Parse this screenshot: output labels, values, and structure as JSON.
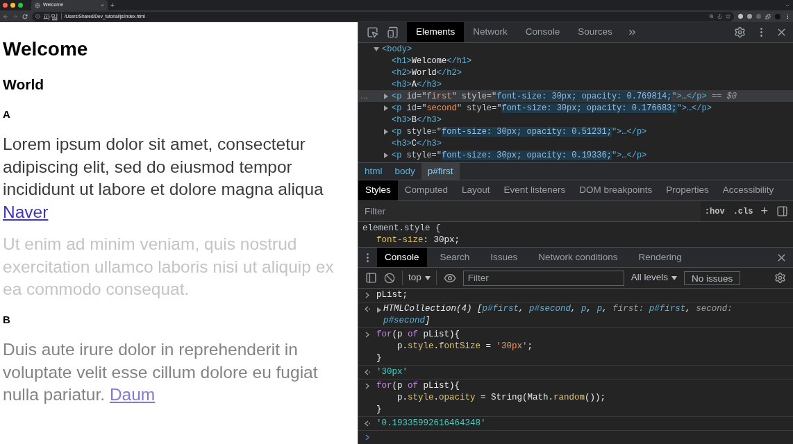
{
  "browser": {
    "tab": {
      "title": "Welcome",
      "close": "×"
    },
    "new_tab": "+",
    "address": {
      "scheme": "파일",
      "url": "/Users/Shared/Dev_tutorial/js/index.html"
    }
  },
  "page": {
    "blocks": [
      {
        "kind": "h1",
        "text": "Welcome"
      },
      {
        "kind": "h2",
        "text": "World"
      },
      {
        "kind": "h3",
        "text": "A"
      },
      {
        "kind": "p",
        "color": "#3b3b3b",
        "text": "Lorem ipsum dolor sit amet, consectetur adipiscing elit, sed do eiusmod tempor incididunt ut labore et dolore magna aliqua",
        "link": {
          "text": "Naver",
          "color": "#3f37b9"
        }
      },
      {
        "kind": "p",
        "color": "#c4c4c4",
        "text": "Ut enim ad minim veniam, quis nostrud exercitation ullamco laboris nisi ut aliquip ex ea commodo consequat."
      },
      {
        "kind": "h3",
        "text": "B"
      },
      {
        "kind": "p",
        "color": "#838383",
        "text": "Duis aute irure dolor in reprehenderit in voluptate velit esse cillum dolore eu fugiat nulla pariatur.",
        "link": {
          "text": "Daum",
          "color": "#7f79d2"
        }
      }
    ]
  },
  "devtools": {
    "tabs": [
      {
        "label": "Elements",
        "selected": true
      },
      {
        "label": "Network",
        "selected": false
      },
      {
        "label": "Console",
        "selected": false
      },
      {
        "label": "Sources",
        "selected": false
      }
    ],
    "tree": [
      {
        "selected": false,
        "expanded": true,
        "segments": [
          {
            "kind": "tag",
            "t": "<body>"
          }
        ],
        "children": [
          {
            "selected": false,
            "segments": [
              {
                "kind": "tag",
                "t": "<h1>"
              },
              {
                "kind": "text",
                "t": "Welcome"
              },
              {
                "kind": "tag",
                "t": "</h1>"
              }
            ]
          },
          {
            "selected": false,
            "segments": [
              {
                "kind": "tag",
                "t": "<h2>"
              },
              {
                "kind": "text",
                "t": "World"
              },
              {
                "kind": "tag",
                "t": "</h2>"
              }
            ]
          },
          {
            "selected": false,
            "segments": [
              {
                "kind": "tag",
                "t": "<h3>"
              },
              {
                "kind": "text",
                "t": "A"
              },
              {
                "kind": "tag",
                "t": "</h3>"
              }
            ]
          },
          {
            "selected": true,
            "gutter": "…",
            "expanded": false,
            "segments": [
              {
                "kind": "tag",
                "t": "<p "
              },
              {
                "kind": "attr",
                "t": "id=\""
              },
              {
                "kind": "str",
                "t": "first"
              },
              {
                "kind": "attr",
                "t": "\" style=\""
              },
              {
                "kind": "val",
                "t": "font-size: 30px; opacity: 0.769814;"
              },
              {
                "kind": "tag",
                "t": "\">…</p>"
              },
              {
                "kind": "dim",
                "t": " == $0"
              }
            ]
          },
          {
            "selected": false,
            "expanded": false,
            "segments": [
              {
                "kind": "tag",
                "t": "<p "
              },
              {
                "kind": "attr",
                "t": "id=\""
              },
              {
                "kind": "str",
                "t": "second"
              },
              {
                "kind": "attr",
                "t": "\" style=\""
              },
              {
                "kind": "val",
                "t": "font-size: 30px; opacity: 0.176683;"
              },
              {
                "kind": "tag",
                "t": "\">…</p>"
              }
            ]
          },
          {
            "selected": false,
            "segments": [
              {
                "kind": "tag",
                "t": "<h3>"
              },
              {
                "kind": "text",
                "t": "B"
              },
              {
                "kind": "tag",
                "t": "</h3>"
              }
            ]
          },
          {
            "selected": false,
            "expanded": false,
            "segments": [
              {
                "kind": "tag",
                "t": "<p "
              },
              {
                "kind": "attr",
                "t": "style=\""
              },
              {
                "kind": "val",
                "t": "font-size: 30px; opacity: 0.51231;"
              },
              {
                "kind": "tag",
                "t": "\">…</p>"
              }
            ]
          },
          {
            "selected": false,
            "segments": [
              {
                "kind": "tag",
                "t": "<h3>"
              },
              {
                "kind": "text",
                "t": "C"
              },
              {
                "kind": "tag",
                "t": "</h3>"
              }
            ]
          },
          {
            "selected": false,
            "expanded": false,
            "segments": [
              {
                "kind": "tag",
                "t": "<p "
              },
              {
                "kind": "attr",
                "t": "style=\""
              },
              {
                "kind": "val",
                "t": "font-size: 30px; opacity: 0.19336;"
              },
              {
                "kind": "tag",
                "t": "\">…</p>"
              }
            ]
          }
        ]
      }
    ],
    "breadcrumbs": [
      {
        "label": "html",
        "selected": false
      },
      {
        "label": "body",
        "selected": false
      },
      {
        "label": "p#first",
        "selected": true
      }
    ],
    "style_tabs": [
      {
        "label": "Styles",
        "selected": true
      },
      {
        "label": "Computed",
        "selected": false
      },
      {
        "label": "Layout",
        "selected": false
      },
      {
        "label": "Event listeners",
        "selected": false
      },
      {
        "label": "DOM breakpoints",
        "selected": false
      },
      {
        "label": "Properties",
        "selected": false
      },
      {
        "label": "Accessibility",
        "selected": false
      }
    ],
    "styles_filter": {
      "placeholder": "Filter",
      "hov": ":hov",
      "cls": ".cls",
      "add": "+"
    },
    "rules": [
      {
        "selector": "element.style {",
        "declaration": [
          {
            "kind": "prop",
            "t": "font-size"
          },
          {
            "kind": "code",
            "t": ": 30px;"
          }
        ]
      }
    ],
    "drawer_tabs": [
      {
        "label": "Console",
        "selected": true
      },
      {
        "label": "Search",
        "selected": false
      },
      {
        "label": "Issues",
        "selected": false
      },
      {
        "label": "Network conditions",
        "selected": false
      },
      {
        "label": "Rendering",
        "selected": false
      }
    ],
    "console_toolbar": {
      "context": "top",
      "filter_placeholder": "Filter",
      "levels": "All levels",
      "issues": "No issues"
    },
    "console": [
      {
        "kind": "input",
        "lines": [
          [
            {
              "kind": "code",
              "t": "pList;"
            }
          ]
        ]
      },
      {
        "kind": "result",
        "lines": [
          [
            {
              "kind": "obj",
              "t": "HTMLCollection(4) ["
            },
            {
              "kind": "ref",
              "t": "p#first"
            },
            {
              "kind": "obj",
              "t": ", "
            },
            {
              "kind": "ref",
              "t": "p#second"
            },
            {
              "kind": "obj",
              "t": ", "
            },
            {
              "kind": "ref",
              "t": "p"
            },
            {
              "kind": "obj",
              "t": ", "
            },
            {
              "kind": "ref",
              "t": "p"
            },
            {
              "kind": "obj",
              "t": ", "
            },
            {
              "kind": "key",
              "t": "first: "
            },
            {
              "kind": "ref",
              "t": "p#first"
            },
            {
              "kind": "obj",
              "t": ", "
            },
            {
              "kind": "key",
              "t": "second:"
            }
          ],
          [
            {
              "kind": "ref",
              "t": "p#second"
            },
            {
              "kind": "obj",
              "t": "]"
            }
          ]
        ]
      },
      {
        "kind": "input",
        "lines": [
          [
            {
              "kind": "kw",
              "t": "for"
            },
            {
              "kind": "code",
              "t": "(p "
            },
            {
              "kind": "kw",
              "t": "of"
            },
            {
              "kind": "code",
              "t": " pList){"
            }
          ],
          [
            {
              "kind": "code",
              "t": "    p."
            },
            {
              "kind": "prop",
              "t": "style"
            },
            {
              "kind": "code",
              "t": "."
            },
            {
              "kind": "prop",
              "t": "fontSize"
            },
            {
              "kind": "code",
              "t": " = "
            },
            {
              "kind": "str",
              "t": "'30px'"
            },
            {
              "kind": "code",
              "t": ";"
            }
          ],
          [
            {
              "kind": "code",
              "t": "}"
            }
          ]
        ]
      },
      {
        "kind": "output",
        "lines": [
          [
            {
              "kind": "res",
              "t": "'30px'"
            }
          ]
        ]
      },
      {
        "kind": "input",
        "lines": [
          [
            {
              "kind": "kw",
              "t": "for"
            },
            {
              "kind": "code",
              "t": "(p "
            },
            {
              "kind": "kw",
              "t": "of"
            },
            {
              "kind": "code",
              "t": " pList){"
            }
          ],
          [
            {
              "kind": "code",
              "t": "    p."
            },
            {
              "kind": "prop",
              "t": "style"
            },
            {
              "kind": "code",
              "t": "."
            },
            {
              "kind": "prop",
              "t": "opacity"
            },
            {
              "kind": "code",
              "t": " = String(Math."
            },
            {
              "kind": "prop",
              "t": "random"
            },
            {
              "kind": "code",
              "t": "());"
            }
          ],
          [
            {
              "kind": "code",
              "t": "}"
            }
          ]
        ]
      },
      {
        "kind": "output",
        "lines": [
          [
            {
              "kind": "res",
              "t": "'0.19335992616464348'"
            }
          ]
        ]
      },
      {
        "kind": "prompt"
      }
    ]
  }
}
